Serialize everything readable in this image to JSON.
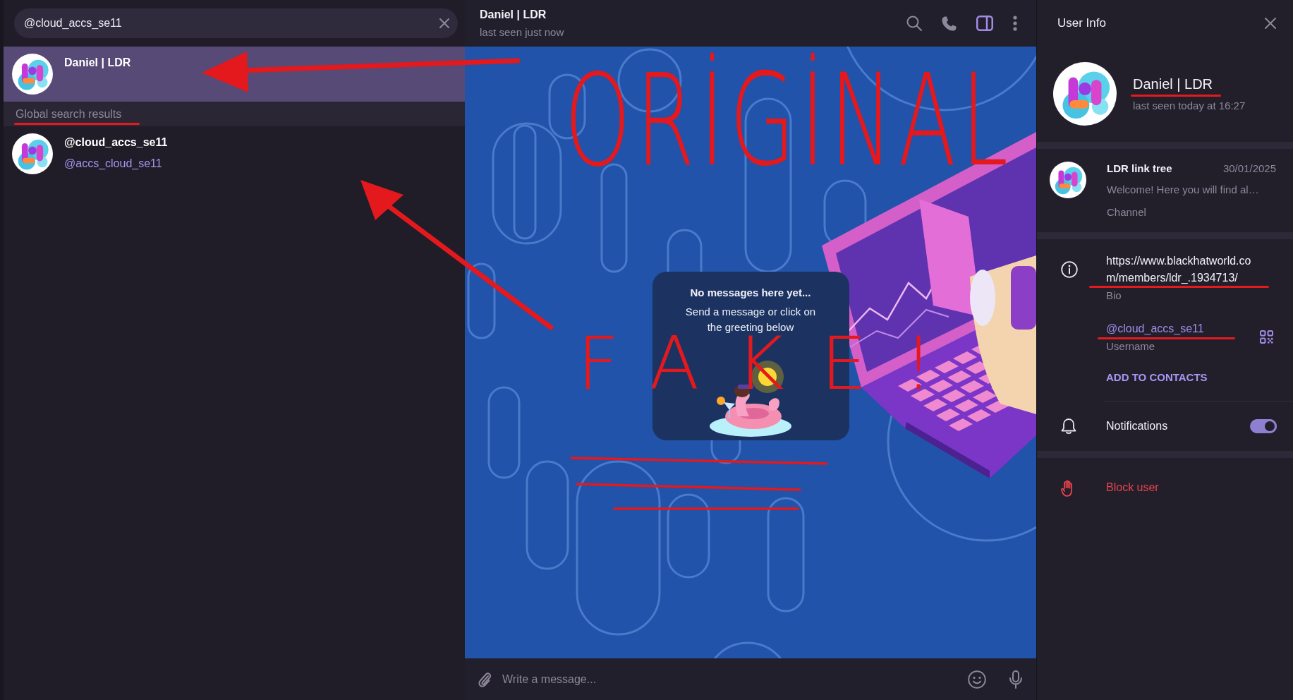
{
  "search": {
    "value": "@cloud_accs_se11"
  },
  "chat_list": [
    {
      "name": "Daniel | LDR",
      "selected": true
    }
  ],
  "global_search": {
    "header": "Global search results",
    "marked": true,
    "results": [
      {
        "name": "@cloud_accs_se11",
        "username": "@accs_cloud_se11",
        "selected": false
      }
    ]
  },
  "chat_header": {
    "title": "Daniel | LDR",
    "status": "last seen just now",
    "tools": [
      {
        "kind": "search",
        "active": false
      },
      {
        "kind": "call",
        "active": false
      },
      {
        "kind": "sidebar",
        "active": true
      },
      {
        "kind": "more",
        "active": false
      }
    ]
  },
  "empty_chat": {
    "title": "No messages here yet...",
    "text": "Send a message or click on the greeting below"
  },
  "composer": {
    "placeholder": "Write a message..."
  },
  "user_info": {
    "title": "User Info",
    "name": "Daniel | LDR",
    "name_marked": true,
    "status": "last seen today at 16:27",
    "channel": {
      "name": "LDR link tree",
      "date": "30/01/2025",
      "preview": "Welcome! Here you will find al…",
      "type": "Channel"
    },
    "bio": {
      "value": "https://www.blackhatworld.com/members/ldr_.1934713/",
      "label": "Bio",
      "marked": true
    },
    "username": {
      "value": "@cloud_accs_se11",
      "label": "Username",
      "marked": true
    },
    "add_contact": "ADD TO CONTACTS",
    "notifications": {
      "label": "Notifications",
      "on": true
    },
    "block": "Block user"
  },
  "annotations": [
    {
      "kind": "handwriting",
      "text": "ORİGİNAL"
    },
    {
      "kind": "arrow"
    },
    {
      "kind": "arrow"
    },
    {
      "kind": "handwriting",
      "text": "FAKE!"
    },
    {
      "kind": "line"
    },
    {
      "kind": "line"
    },
    {
      "kind": "line"
    }
  ]
}
